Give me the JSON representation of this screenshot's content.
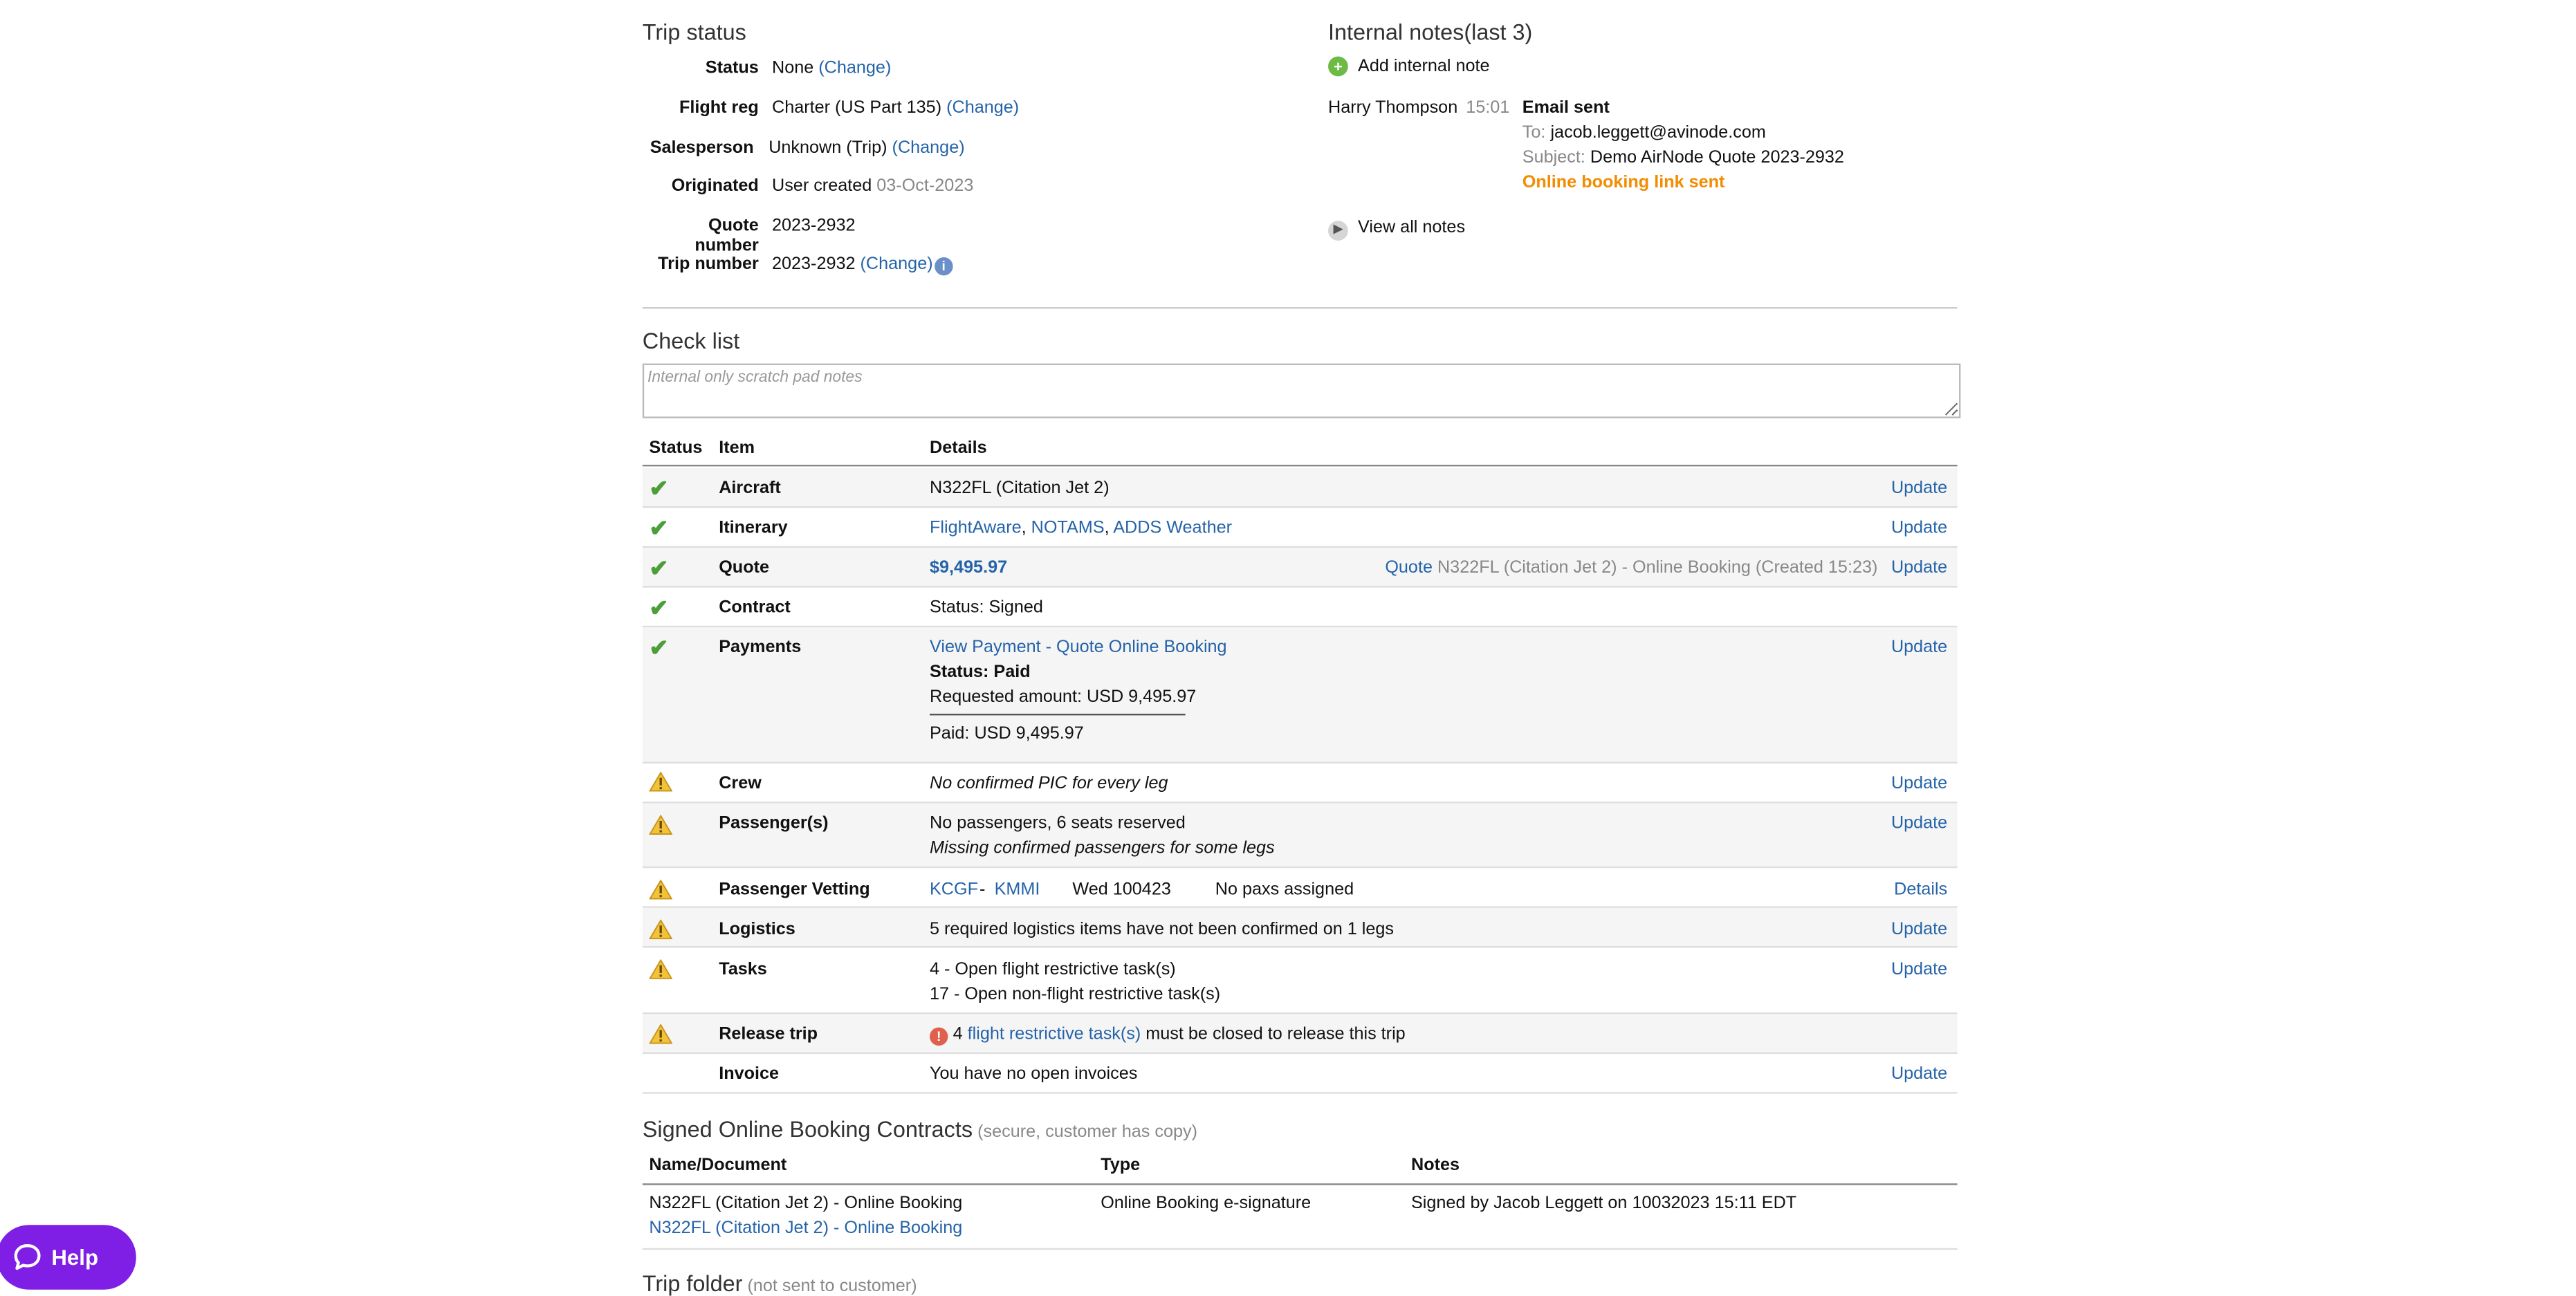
{
  "trip_status": {
    "title": "Trip status",
    "rows": [
      {
        "label": "Status",
        "value": "None",
        "change": "(Change)"
      },
      {
        "label": "Flight reg",
        "value": "Charter (US Part 135)",
        "change": "(Change)"
      },
      {
        "label": "Salesperson",
        "value": "Unknown (Trip)",
        "change": "(Change)"
      },
      {
        "label": "Originated",
        "value": "User created",
        "date": "03-Oct-2023"
      },
      {
        "label": "Quote number",
        "value": "2023-2932"
      },
      {
        "label": "Trip number",
        "value": "2023-2932",
        "change": "(Change)",
        "icon": "info-icon"
      }
    ]
  },
  "internal_notes": {
    "title": "Internal notes(last 3)",
    "add_label": "Add internal note",
    "note": {
      "author": "Harry Thompson",
      "time": "15:01",
      "type": "Email sent",
      "to_label": "To:",
      "to": "jacob.leggett@avinode.com",
      "subject_label": "Subject:",
      "subject": "Demo AirNode Quote 2023-2932",
      "highlight": "Online booking link sent",
      "highlight_color": "#f28c00"
    },
    "view_all_label": "View all notes"
  },
  "checklist": {
    "title": "Check list",
    "scratch_placeholder": "Internal only scratch pad notes",
    "headers": {
      "status": "Status",
      "item": "Item",
      "details": "Details"
    },
    "rows": {
      "aircraft": {
        "status": "check",
        "item": "Aircraft",
        "details": "N322FL (Citation Jet 2)",
        "action": "Update"
      },
      "itinerary": {
        "status": "check",
        "item": "Itinerary",
        "links": [
          "FlightAware",
          "NOTAMS",
          "ADDS Weather"
        ],
        "sep": ",",
        "action": "Update"
      },
      "quote": {
        "status": "check",
        "item": "Quote",
        "amount": "$9,495.97",
        "quote_link": "Quote",
        "quote_info": "N322FL (Citation Jet 2) - Online Booking (Created 15:23)",
        "action": "Update"
      },
      "contract": {
        "status": "check",
        "item": "Contract",
        "details": "Status: Signed"
      },
      "payments": {
        "status": "check",
        "item": "Payments",
        "link": "View Payment - Quote Online Booking",
        "status_text": "Status: Paid",
        "requested": "Requested amount: USD 9,495.97",
        "paid": "Paid: USD 9,495.97",
        "action": "Update"
      },
      "crew": {
        "status": "warning",
        "item": "Crew",
        "details": "No confirmed PIC for every leg",
        "action": "Update"
      },
      "passengers": {
        "status": "warning",
        "item": "Passenger(s)",
        "details": "No passengers, 6 seats reserved",
        "details2": "Missing confirmed passengers for some legs",
        "action": "Update"
      },
      "vetting": {
        "status": "warning",
        "item": "Passenger Vetting",
        "from": "KCGF",
        "dash": "-",
        "to": "KMMI",
        "date": "Wed 100423",
        "paxs": "No paxs assigned",
        "action": "Details"
      },
      "logistics": {
        "status": "warning",
        "item": "Logistics",
        "details": "5 required logistics items have not been confirmed on 1 legs",
        "action": "Update"
      },
      "tasks": {
        "status": "warning",
        "item": "Tasks",
        "details": "4 - Open flight restrictive task(s)",
        "details2": "17 - Open non-flight restrictive task(s)",
        "action": "Update"
      },
      "release": {
        "status": "warning",
        "item": "Release trip",
        "count": "4",
        "link": "flight restrictive task(s)",
        "suffix": "must be closed to release this trip"
      },
      "invoice": {
        "item": "Invoice",
        "details": "You have no open invoices",
        "action": "Update"
      }
    }
  },
  "contracts": {
    "title": "Signed Online Booking Contracts",
    "subtitle": "(secure, customer has copy)",
    "headers": {
      "name": "Name/Document",
      "type": "Type",
      "notes": "Notes"
    },
    "row": {
      "name": "N322FL (Citation Jet 2) - Online Booking",
      "link": "N322FL (Citation Jet 2) - Online Booking",
      "type": "Online Booking e-signature",
      "notes": "Signed by Jacob Leggett on 10032023 15:11 EDT"
    }
  },
  "trip_folder": {
    "title": "Trip folder",
    "subtitle": "(not sent to customer)"
  },
  "help": {
    "label": "Help",
    "icon": "chat-bubble-icon",
    "color": "#7f1fe6"
  },
  "colors": {
    "link": "#2563a8",
    "check": "#4b9e3a",
    "warning": "#f2c23a"
  }
}
